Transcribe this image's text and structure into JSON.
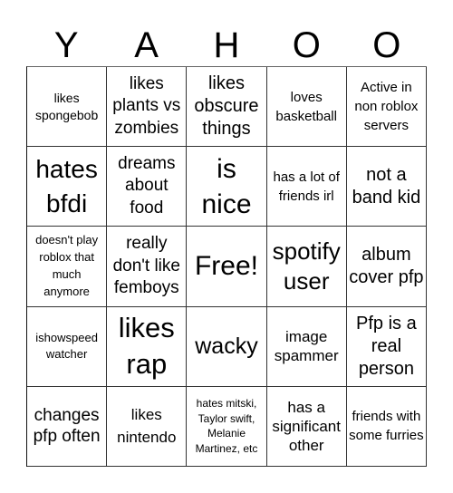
{
  "header": {
    "letters": [
      "Y",
      "A",
      "H",
      "O",
      "O"
    ]
  },
  "board": {
    "rows": [
      [
        {
          "text": "likes spongebob"
        },
        {
          "text": "likes plants vs zombies"
        },
        {
          "text": "likes obscure things"
        },
        {
          "text": "loves basketball"
        },
        {
          "text": "Active in non roblox servers"
        }
      ],
      [
        {
          "text": "hates bfdi"
        },
        {
          "text": "dreams about food"
        },
        {
          "text": "is nice"
        },
        {
          "text": "has a lot of friends irl"
        },
        {
          "text": "not a band kid"
        }
      ],
      [
        {
          "text": "doesn't play roblox that much anymore"
        },
        {
          "text": "really don't like femboys"
        },
        {
          "text": "Free!"
        },
        {
          "text": "spotify user"
        },
        {
          "text": "album cover pfp"
        }
      ],
      [
        {
          "text": "ishowspeed watcher"
        },
        {
          "text": "likes rap"
        },
        {
          "text": "wacky"
        },
        {
          "text": "image spammer"
        },
        {
          "text": "Pfp is a real person"
        }
      ],
      [
        {
          "text": "changes pfp often"
        },
        {
          "text": "likes nintendo"
        },
        {
          "text": "hates mitski, Taylor swift, Melanie Martinez, etc"
        },
        {
          "text": "has a significant other"
        },
        {
          "text": "friends with some furries"
        }
      ]
    ]
  }
}
